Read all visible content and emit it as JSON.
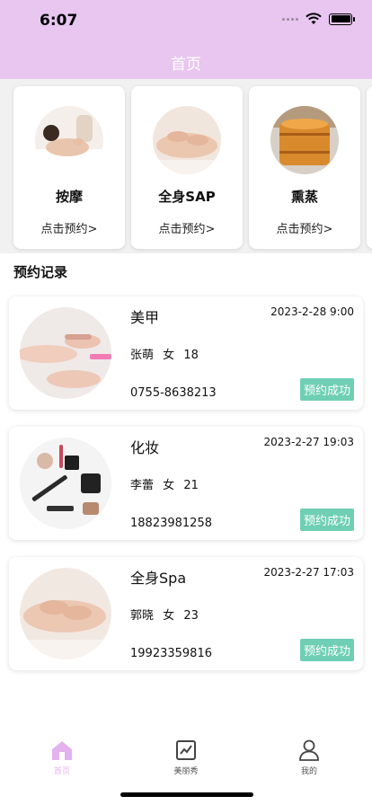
{
  "status_bar": {
    "time": "6:07"
  },
  "header": {
    "title": "首页"
  },
  "categories": [
    {
      "name": "按摩",
      "action": "点击预约>"
    },
    {
      "name": "全身SAP",
      "action": "点击预约>"
    },
    {
      "name": "熏蒸",
      "action": "点击预约>"
    }
  ],
  "records_section": {
    "title": "预约记录"
  },
  "records": [
    {
      "service": "美甲",
      "datetime": "2023-2-28 9:00",
      "name": "张萌",
      "gender": "女",
      "age": "18",
      "phone": "0755-8638213",
      "status": "预约成功"
    },
    {
      "service": "化妆",
      "datetime": "2023-2-27 19:03",
      "name": "李蕾",
      "gender": "女",
      "age": "21",
      "phone": "18823981258",
      "status": "预约成功"
    },
    {
      "service": "全身Spa",
      "datetime": "2023-2-27 17:03",
      "name": "郭晓",
      "gender": "女",
      "age": "23",
      "phone": "19923359816",
      "status": "预约成功"
    }
  ],
  "tabbar": [
    {
      "label": "首页",
      "icon": "home-icon",
      "active": true
    },
    {
      "label": "美丽秀",
      "icon": "chart-icon",
      "active": false
    },
    {
      "label": "我的",
      "icon": "user-icon",
      "active": false
    }
  ],
  "colors": {
    "header_bg": "#e8c6f0",
    "status_badge": "#6fcfb4",
    "tab_active": "#e3b3ee"
  }
}
